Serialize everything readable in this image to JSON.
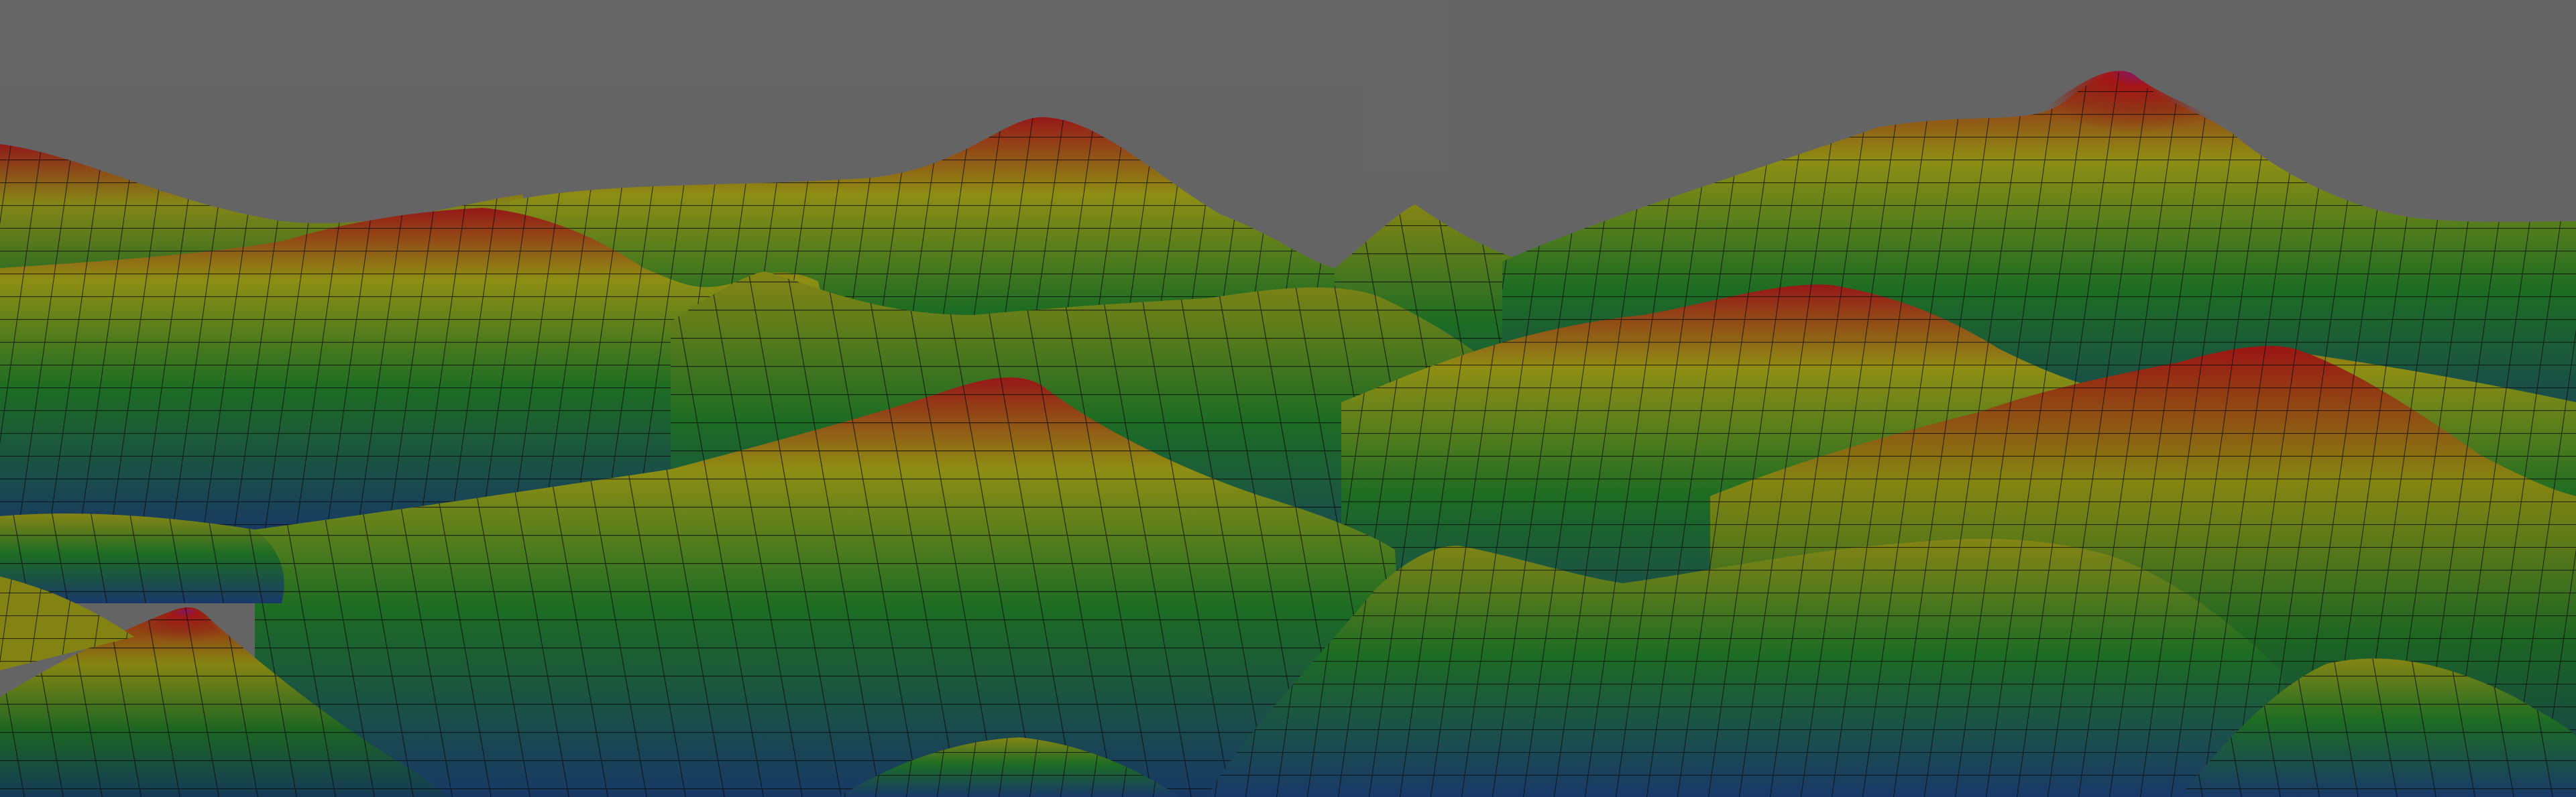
{
  "scene": {
    "type": "3d-terrain-heightmap-render",
    "background_color": "#6b6b6b",
    "wireframe_color": "#0a0a0a",
    "shading": "dim",
    "colormap": [
      {
        "level": 0.0,
        "color": "#1f3f78"
      },
      {
        "level": 0.25,
        "color": "#1f7a2a"
      },
      {
        "level": 0.55,
        "color": "#9a9a16"
      },
      {
        "level": 0.8,
        "color": "#b01818"
      },
      {
        "level": 1.0,
        "color": "#8a1a78"
      }
    ]
  }
}
